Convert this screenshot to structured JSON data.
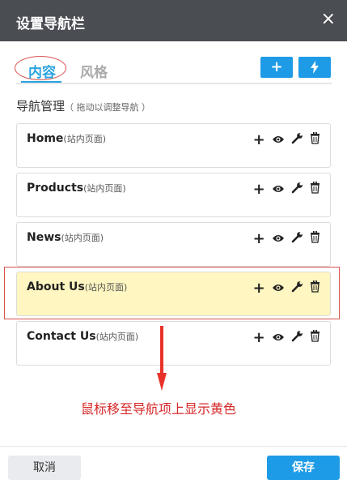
{
  "dialog": {
    "title": "设置导航栏",
    "close_symbol": "×"
  },
  "tabs": [
    {
      "label": "内容"
    },
    {
      "label": "风格"
    }
  ],
  "toolbar": {
    "add_symbol": "+",
    "flash_symbol": "ϟ"
  },
  "section": {
    "title": "导航管理",
    "hint": "（ 拖动以调整导航 ）"
  },
  "nav_items": [
    {
      "name": "Home",
      "type": "(站内页面)"
    },
    {
      "name": "Products",
      "type": "(站内页面)"
    },
    {
      "name": "News",
      "type": "(站内页面)"
    },
    {
      "name": "About Us",
      "type": "(站内页面)"
    },
    {
      "name": "Contact Us",
      "type": "(站内页面)"
    }
  ],
  "hover_color": "#fff6c1",
  "annotation": "鼠标移至导航项上显示黄色",
  "footer": {
    "cancel_label": "取消",
    "save_label": "保存"
  }
}
